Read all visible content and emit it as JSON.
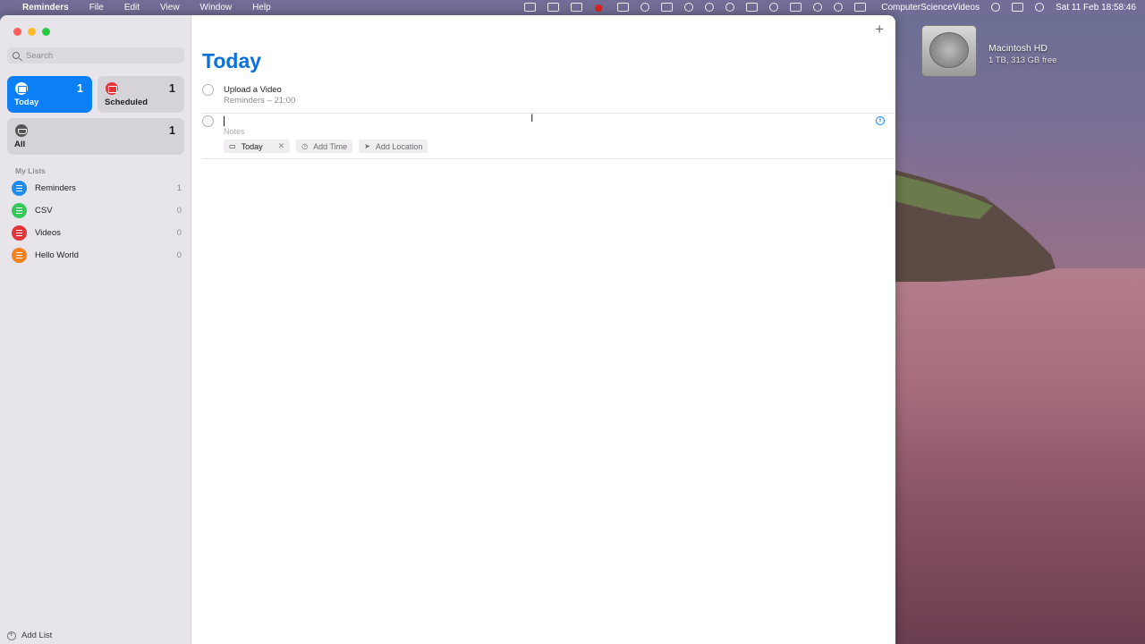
{
  "menubar": {
    "apple": "",
    "app": "Reminders",
    "menus": [
      "File",
      "Edit",
      "View",
      "Window",
      "Help"
    ],
    "user": "ComputerScienceVideos",
    "clock": "Sat 11 Feb  18:58:46"
  },
  "desktop": {
    "disk_name": "Macintosh HD",
    "disk_info": "1 TB, 313 GB free"
  },
  "sidebar": {
    "search_placeholder": "Search",
    "smart": [
      {
        "label": "Today",
        "count": "1"
      },
      {
        "label": "Scheduled",
        "count": "1"
      },
      {
        "label": "All",
        "count": "1"
      }
    ],
    "my_lists_heading": "My Lists",
    "lists": [
      {
        "label": "Reminders",
        "count": "1",
        "color": "#1f8cf0"
      },
      {
        "label": "CSV",
        "count": "0",
        "color": "#34c759"
      },
      {
        "label": "Videos",
        "count": "0",
        "color": "#e5353a"
      },
      {
        "label": "Hello World",
        "count": "0",
        "color": "#f7821b"
      }
    ],
    "add_list": "Add List"
  },
  "main": {
    "title": "Today",
    "reminders": [
      {
        "title": "Upload a Video",
        "subtitle": "Reminders – 21:00"
      }
    ],
    "new_reminder": {
      "notes_placeholder": "Notes",
      "date_chip": "Today",
      "add_time": "Add Time",
      "add_location": "Add Location"
    }
  }
}
